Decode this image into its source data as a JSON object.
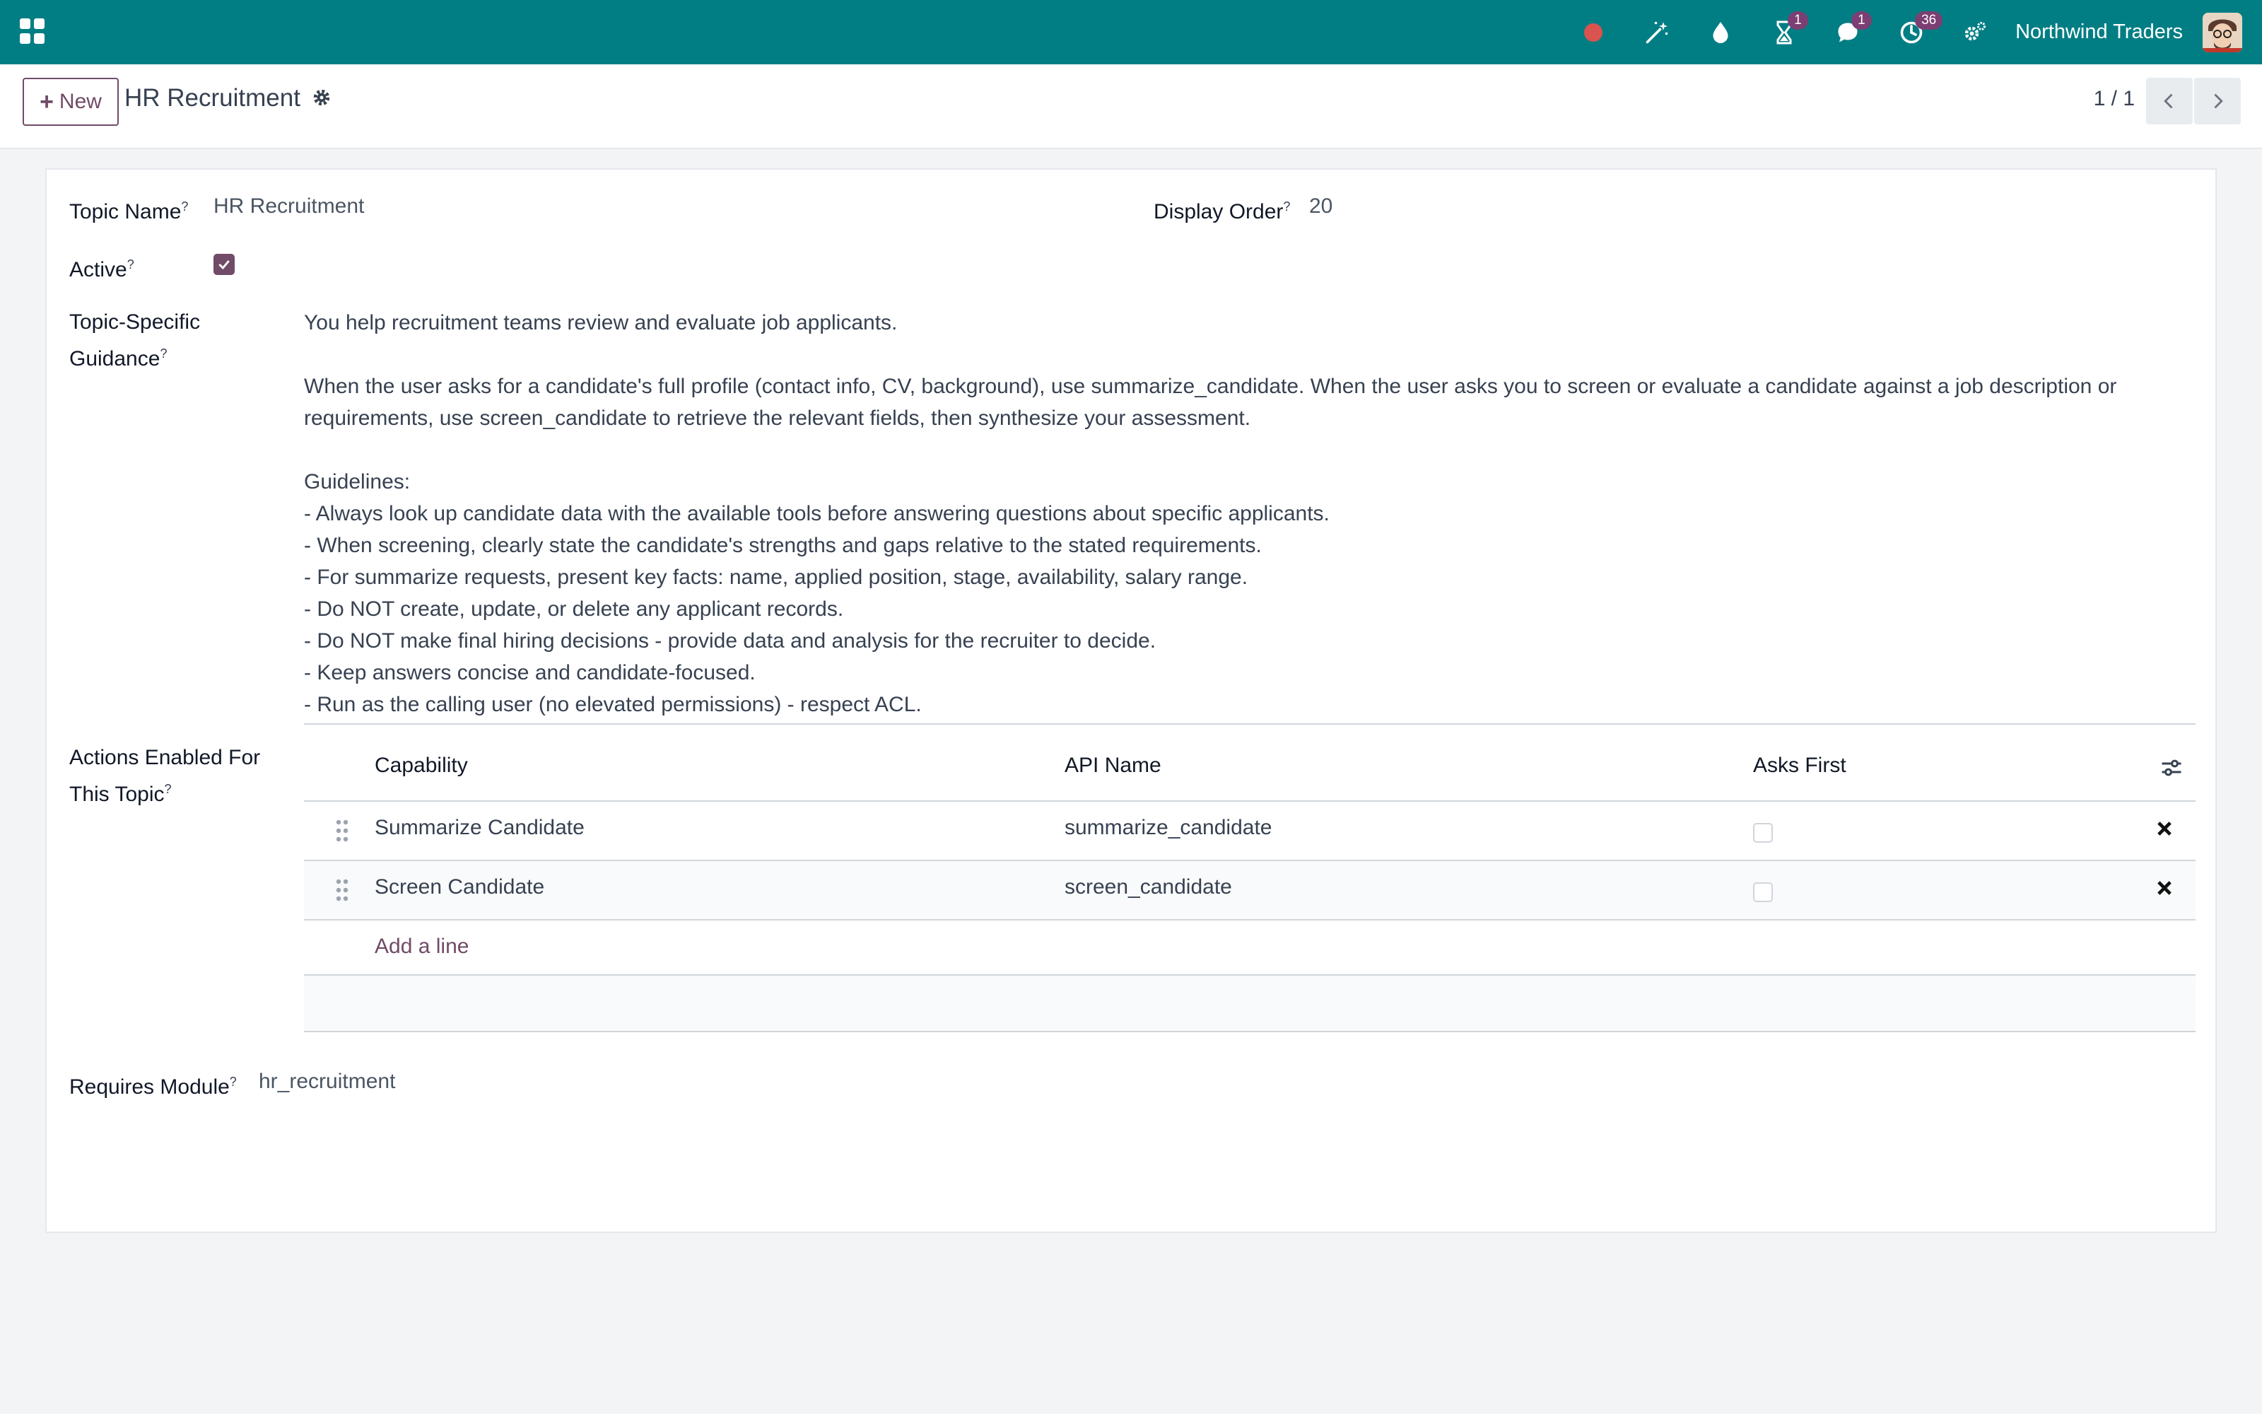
{
  "navbar": {
    "company": "Northwind Traders",
    "badges": {
      "activities": "1",
      "messages": "1",
      "clock": "36"
    },
    "icons": [
      "apps-icon",
      "record-dot-icon",
      "magic-wand-icon",
      "drop-icon",
      "hourglass-icon",
      "chat-icon",
      "clock-icon",
      "settings-gears-icon",
      "avatar"
    ]
  },
  "controlbar": {
    "new_label": "New",
    "title": "HR Recruitment",
    "pager": "1 / 1"
  },
  "form": {
    "topic_name_label": "Topic Name",
    "topic_name_value": "HR Recruitment",
    "display_order_label": "Display Order",
    "display_order_value": "20",
    "active_label": "Active",
    "guidance_label_1": "Topic-Specific",
    "guidance_label_2": "Guidance",
    "guidance_lines": [
      "You help recruitment teams review and evaluate job applicants.",
      "",
      "When the user asks for a candidate's full profile (contact info, CV, background), use summarize_candidate. When the user asks you to screen or evaluate a candidate against a job description or",
      "requirements, use screen_candidate to retrieve the relevant fields, then synthesize your assessment.",
      "",
      "Guidelines:",
      "- Always look up candidate data with the available tools before answering questions about specific applicants.",
      "- When screening, clearly state the candidate's strengths and gaps relative to the stated requirements.",
      "- For summarize requests, present key facts: name, applied position, stage, availability, salary range.",
      "- Do NOT create, update, or delete any applicant records.",
      "- Do NOT make final hiring decisions - provide data and analysis for the recruiter to decide.",
      "- Keep answers concise and candidate-focused.",
      "- Run as the calling user (no elevated permissions) - respect ACL."
    ],
    "actions_label_1": "Actions Enabled For",
    "actions_label_2": "This Topic",
    "requires_module_label": "Requires Module",
    "requires_module_value": "hr_recruitment",
    "help_mark": "?"
  },
  "actions_table": {
    "columns": {
      "capability": "Capability",
      "api_name": "API Name",
      "asks_first": "Asks First"
    },
    "rows": [
      {
        "capability": "Summarize Candidate",
        "api_name": "summarize_candidate",
        "asks_first": false
      },
      {
        "capability": "Screen Candidate",
        "api_name": "screen_candidate",
        "asks_first": false
      }
    ],
    "add_line": "Add a line"
  },
  "colors": {
    "navbar": "#017e84",
    "accent": "#714b67",
    "badge": "#7b3f73",
    "record": "#d9534f"
  }
}
